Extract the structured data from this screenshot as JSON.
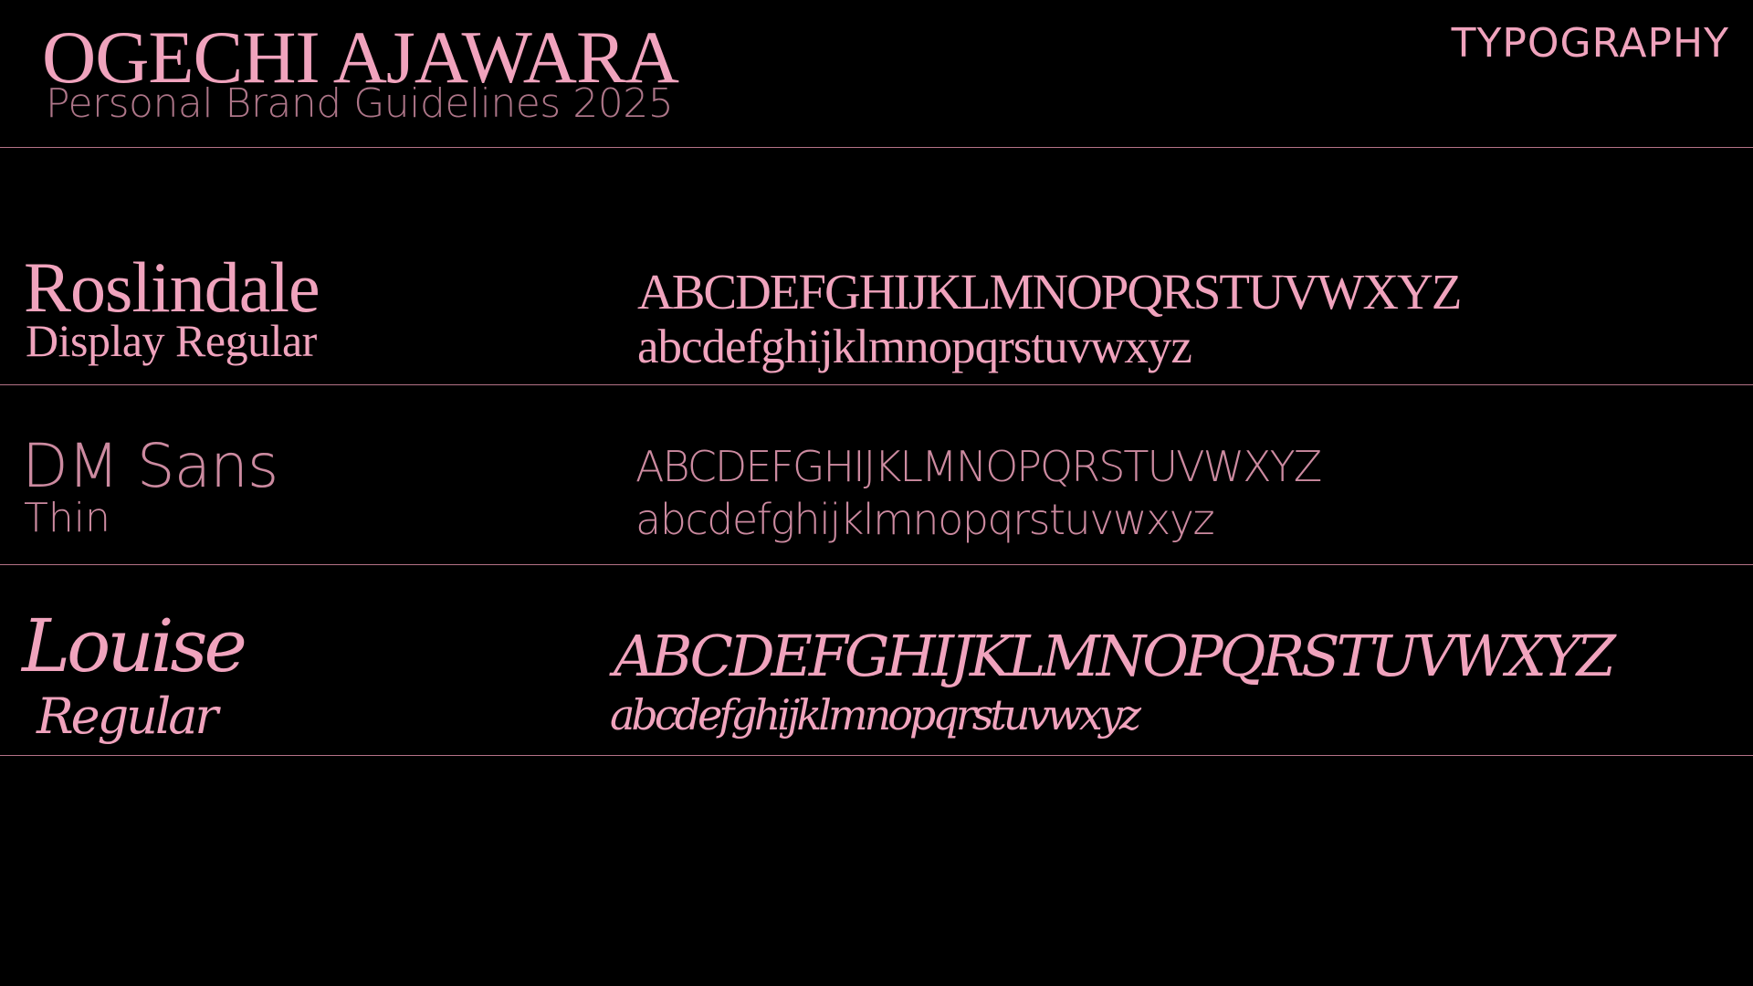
{
  "header": {
    "name": "OGECHI AJAWARA",
    "subtitle": "Personal Brand Guidelines 2025",
    "section": "TYPOGRAPHY"
  },
  "colors": {
    "background": "#000000",
    "accent_pink": "#f0a3bd",
    "divider": "#b47287"
  },
  "fonts": [
    {
      "name": "Roslindale",
      "style": "Display Regular",
      "uppercase": "ABCDEFGHIJKLMNOPQRSTUVWXYZ",
      "lowercase": "abcdefghijklmnopqrstuvwxyz"
    },
    {
      "name": "DM Sans",
      "style": "Thin",
      "uppercase": "ABCDEFGHIJKLMNOPQRSTUVWXYZ",
      "lowercase": "abcdefghijklmnopqrstuvwxyz"
    },
    {
      "name": "Louise",
      "style": "Regular",
      "uppercase": "ABCDEFGHIJKLMNOPQRSTUVWXYZ",
      "lowercase": "abcdefghijklmnopqrstuvwxyz"
    }
  ]
}
